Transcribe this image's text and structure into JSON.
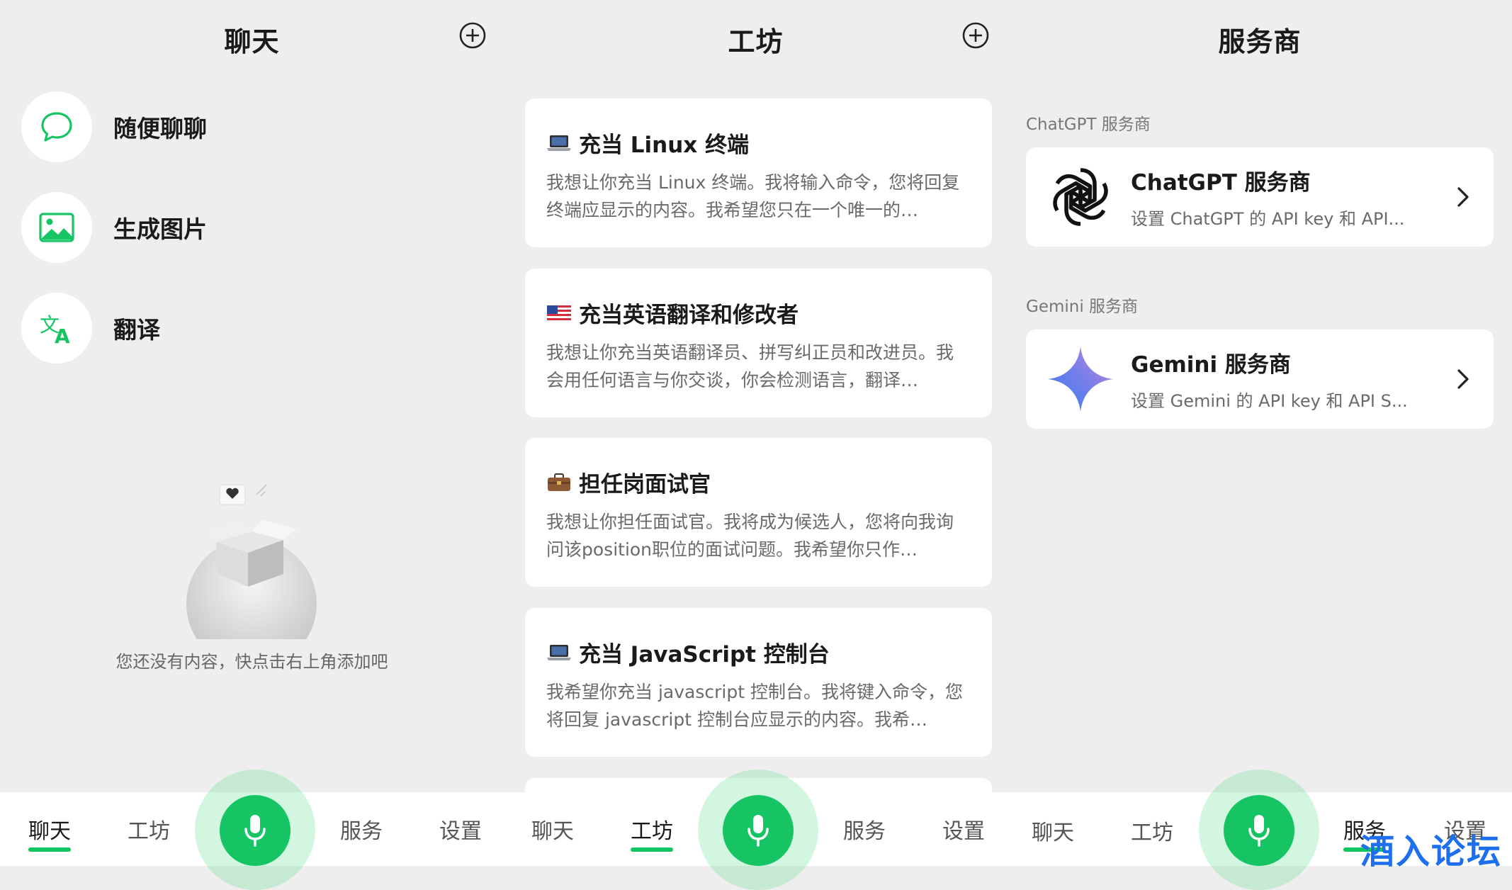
{
  "chat_panel": {
    "title": "聊天",
    "items": [
      {
        "label": "随便聊聊",
        "icon": "speech-bubble-icon"
      },
      {
        "label": "生成图片",
        "icon": "image-icon"
      },
      {
        "label": "翻译",
        "icon": "translate-icon"
      }
    ],
    "empty_text": "您还没有内容，快点击右上角添加吧"
  },
  "workshop_panel": {
    "title": "工坊",
    "cards": [
      {
        "emoji": "laptop-icon",
        "title": "充当 Linux 终端",
        "desc": "我想让你充当 Linux 终端。我将输入命令，您将回复终端应显示的内容。我希望您只在一个唯一的…"
      },
      {
        "emoji": "us-flag-icon",
        "title": "充当英语翻译和修改者",
        "desc": "我想让你充当英语翻译员、拼写纠正员和改进员。我会用任何语言与你交谈，你会检测语言，翻译…"
      },
      {
        "emoji": "briefcase-icon",
        "title": "担任岗面试官",
        "desc": "我想让你担任面试官。我将成为候选人，您将向我询问该position职位的面试问题。我希望你只作…"
      },
      {
        "emoji": "laptop-icon",
        "title": "充当 JavaScript 控制台",
        "desc": "我希望你充当 javascript 控制台。我将键入命令，您将回复 javascript 控制台应显示的内容。我希…"
      }
    ]
  },
  "providers_panel": {
    "title": "服务商",
    "sections": [
      {
        "label": "ChatGPT 服务商",
        "name": "ChatGPT 服务商",
        "desc": "设置 ChatGPT 的 API key 和 API..."
      },
      {
        "label": "Gemini 服务商",
        "name": "Gemini 服务商",
        "desc": "设置 Gemini 的 API key 和 API S..."
      }
    ]
  },
  "nav": {
    "chat": "聊天",
    "workshop": "工坊",
    "service": "服务",
    "settings": "设置"
  },
  "watermark": "酒入论坛",
  "colors": {
    "accent": "#0fc660",
    "background": "#eeeeee"
  }
}
